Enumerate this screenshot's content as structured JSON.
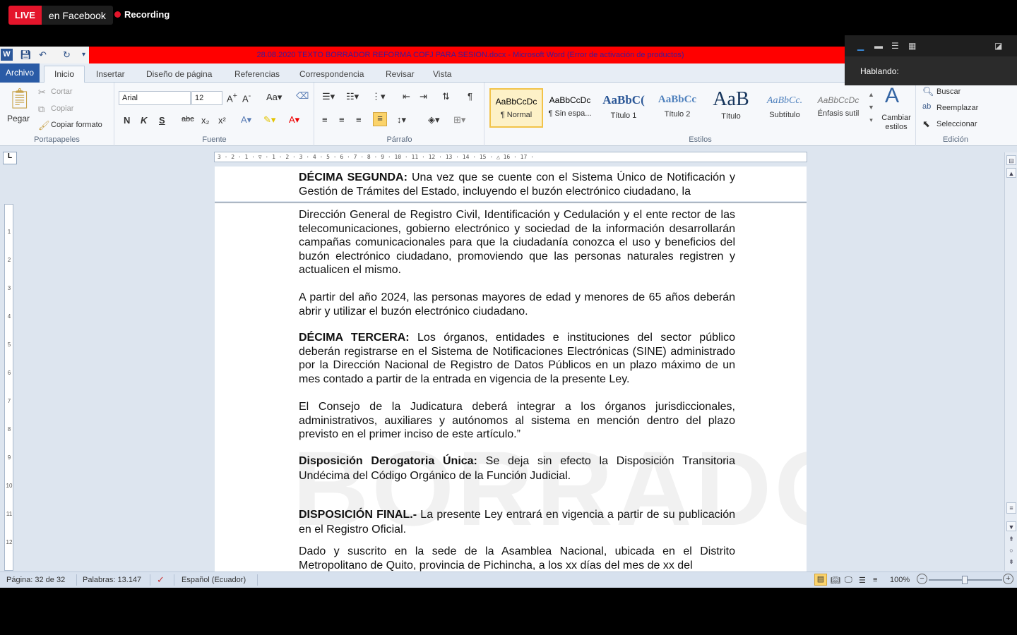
{
  "stream": {
    "live_label": "LIVE",
    "platform_label": "en Facebook",
    "recording_label": "Recording"
  },
  "zoom_panel": {
    "speaking_label": "Hablando:"
  },
  "window": {
    "title": "28.08.2020 TEXTO BORRADOR REFORMA COFJ PARA SESION.docx  -  Microsoft Word (Error de activación de productos)",
    "title_bar_color": "#ff0000"
  },
  "ribbon_tabs": [
    "Archivo",
    "Inicio",
    "Insertar",
    "Diseño de página",
    "Referencias",
    "Correspondencia",
    "Revisar",
    "Vista"
  ],
  "portapapeles": {
    "paste_label": "Pegar",
    "cut_label": "Cortar",
    "copy_label": "Copiar",
    "format_painter_label": "Copiar formato",
    "group_label": "Portapapeles"
  },
  "fuente": {
    "font_name": "Arial",
    "font_size": "12",
    "bold": "N",
    "italic": "K",
    "underline": "S",
    "strike": "abc",
    "group_label": "Fuente"
  },
  "parrafo": {
    "group_label": "Párrafo"
  },
  "estilos": {
    "items": [
      {
        "sample": "AaBbCcDc",
        "name": "¶ Normal"
      },
      {
        "sample": "AaBbCcDc",
        "name": "¶ Sin espa..."
      },
      {
        "sample": "AaBbC(",
        "name": "Título 1"
      },
      {
        "sample": "AaBbCc",
        "name": "Título 2"
      },
      {
        "sample": "AaB",
        "name": "Título"
      },
      {
        "sample": "AaBbCc.",
        "name": "Subtítulo"
      },
      {
        "sample": "AaBbCcDc",
        "name": "Énfasis sutil"
      }
    ],
    "change_styles_label": "Cambiar estilos",
    "group_label": "Estilos"
  },
  "edicion": {
    "find_label": "Buscar",
    "replace_label": "Reemplazar",
    "select_label": "Seleccionar",
    "group_label": "Edición"
  },
  "document": {
    "paragraphs": [
      {
        "bold": "DÉCIMA SEGUNDA:",
        "text": " Una vez que se cuente con el Sistema Único de Notificación y Gestión de Trámites del Estado, incluyendo el buzón electrónico ciudadano, la"
      },
      {
        "bold": "",
        "text": "Dirección General de Registro Civil, Identificación y Cedulación y el ente rector de las telecomunicaciones, gobierno electrónico y sociedad de la información desarrollarán campañas comunicacionales para que la ciudadanía conozca el uso y beneficios del buzón electrónico ciudadano, promoviendo que las personas naturales registren y actualicen el mismo."
      },
      {
        "bold": "",
        "text": "A partir del año 2024, las personas mayores de edad y menores de 65 años deberán abrir y utilizar el buzón electrónico ciudadano."
      },
      {
        "bold": "DÉCIMA TERCERA:",
        "text": " Los órganos, entidades e instituciones del sector público deberán registrarse en el Sistema de Notificaciones Electrónicas (SINE) administrado por la Dirección Nacional de Registro de Datos Públicos en un plazo máximo de un mes contado a partir de la entrada en vigencia de la presente Ley."
      },
      {
        "bold": "",
        "text": "El Consejo de la Judicatura deberá integrar a los órganos jurisdiccionales, administrativos, auxiliares y autónomos al sistema en mención dentro del plazo previsto en el primer inciso de este artículo.”"
      },
      {
        "bold": "Disposición Derogatoria Única:",
        "text": " Se deja sin efecto la Disposición Transitoria Undécima del Código Orgánico de la Función Judicial."
      },
      {
        "bold": "DISPOSICIÓN FINAL.-",
        "text": " La presente Ley entrará en vigencia a partir de su publicación en el Registro Oficial."
      },
      {
        "bold": "",
        "text": "Dado y suscrito en la sede de la Asamblea Nacional, ubicada en el Distrito Metropolitano de Quito, provincia de Pichincha, a los xx días del mes de xx del"
      }
    ],
    "watermark": "BORRADOR"
  },
  "status": {
    "page": "Página: 32 de 32",
    "words": "Palabras: 13.147",
    "language": "Español (Ecuador)",
    "zoom": "100%"
  }
}
